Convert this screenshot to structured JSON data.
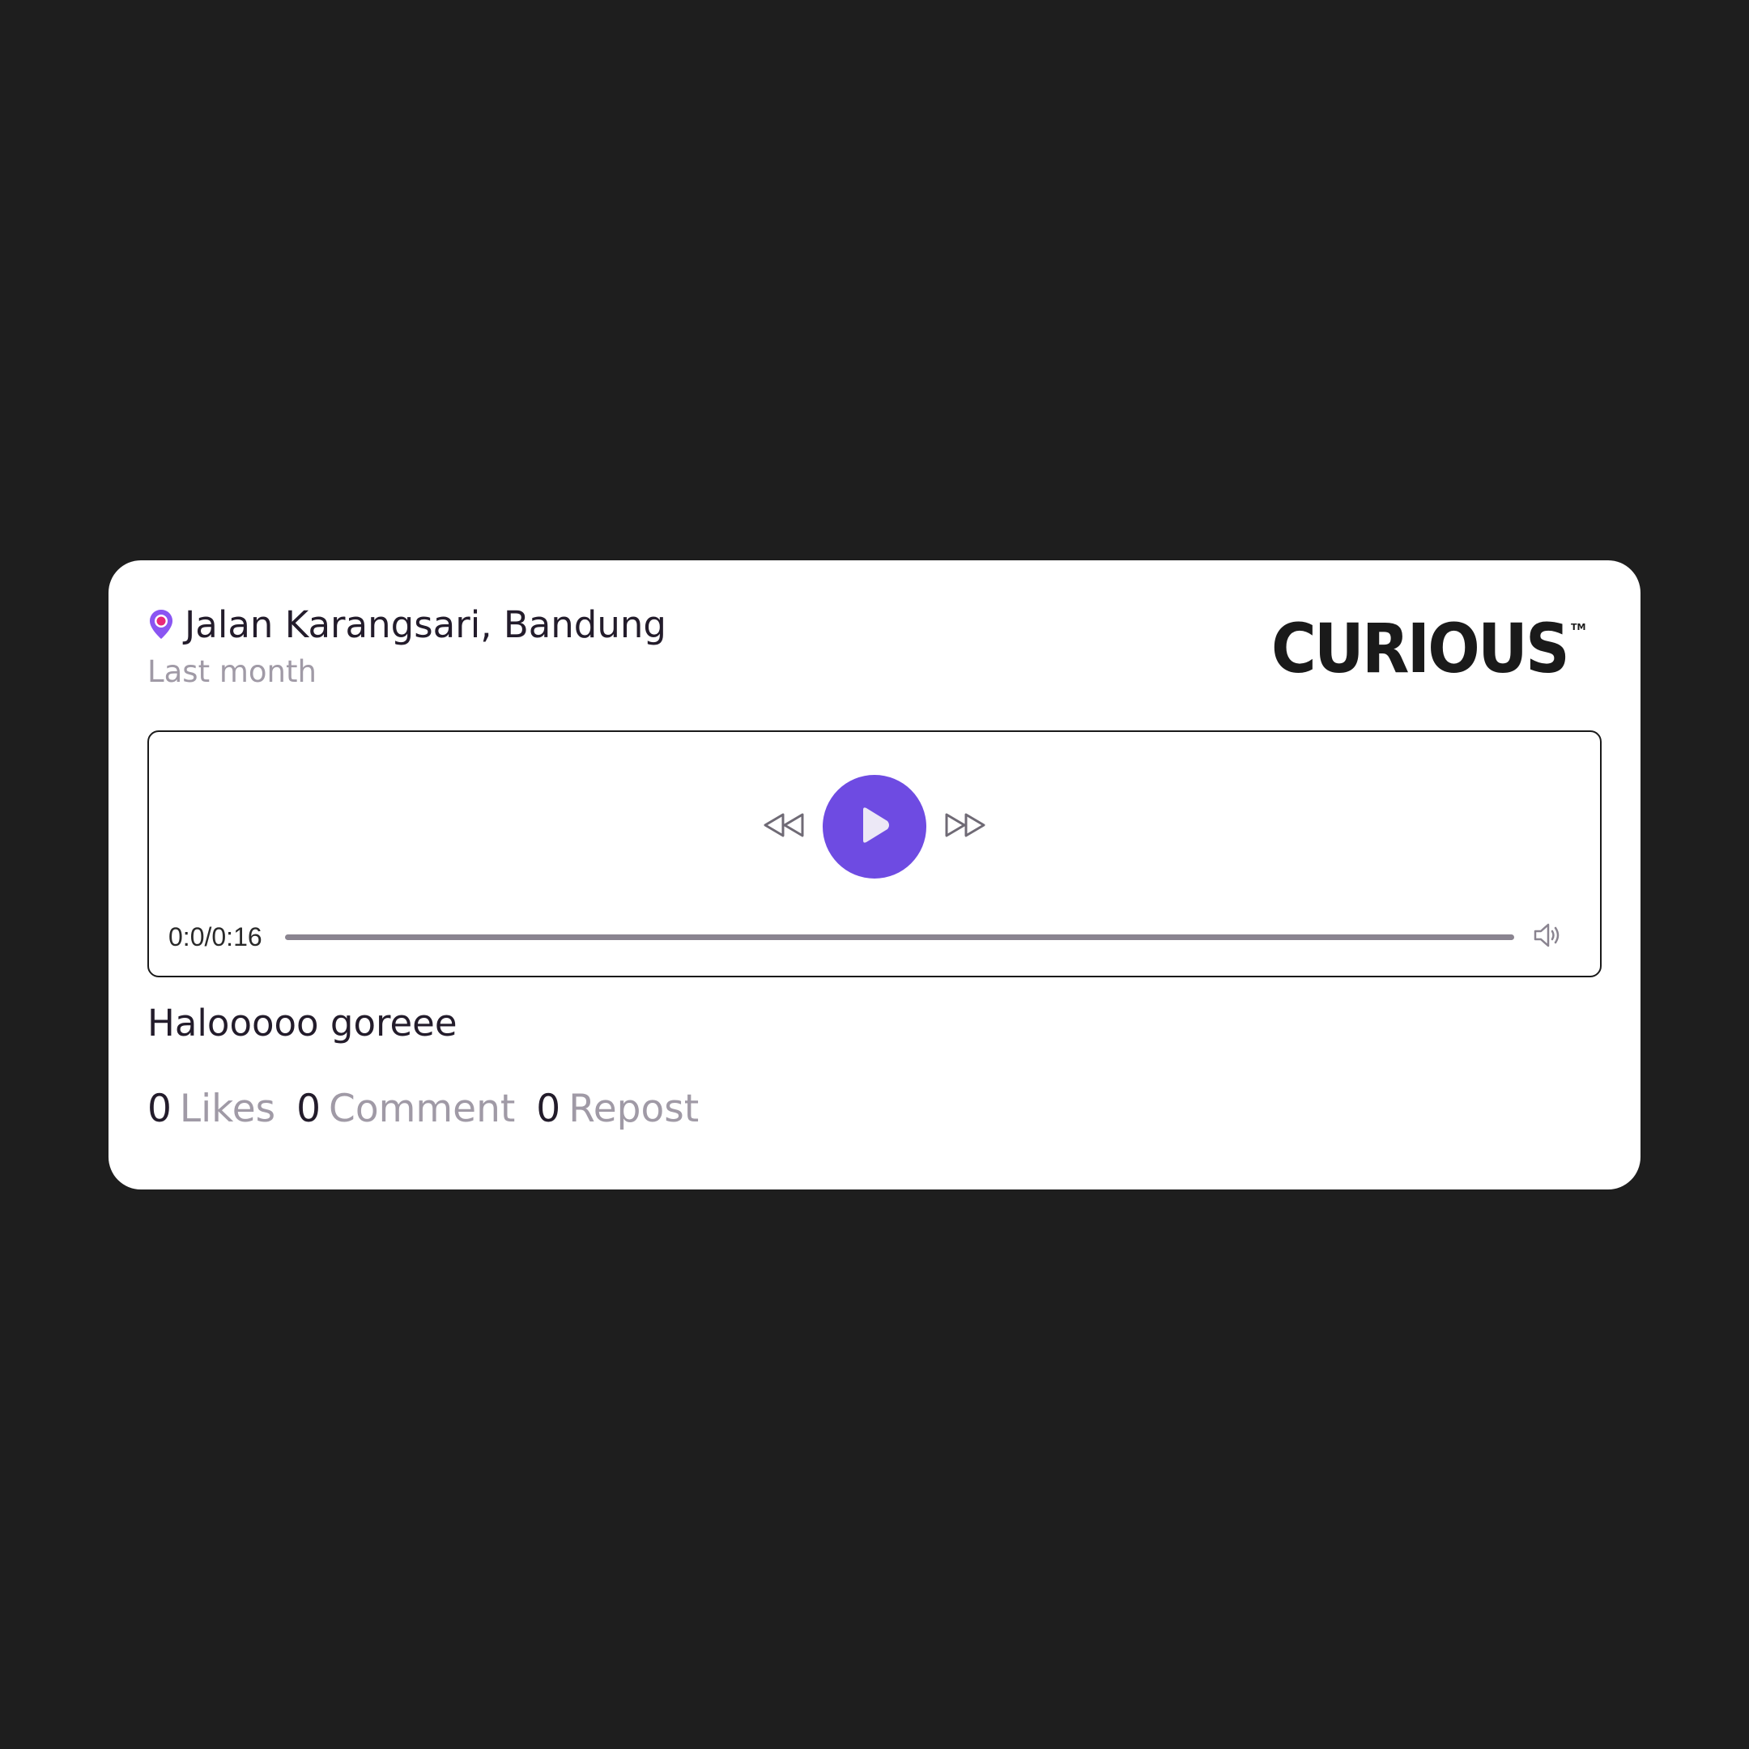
{
  "post": {
    "location": "Jalan Karangsari, Bandung",
    "time": "Last month",
    "caption": "Halooooo goreee"
  },
  "brand": {
    "logo_text": "CURIOUS",
    "trademark": "TM"
  },
  "player": {
    "time_readout": "0:0/0:16",
    "progress": 0,
    "play_icon": "play-icon",
    "rewind_icon": "rewind-icon",
    "forward_icon": "fast-forward-icon",
    "volume_icon": "volume-icon"
  },
  "stats": {
    "likes_count": "0",
    "likes_label": "Likes",
    "comment_count": "0",
    "comment_label": "Comment",
    "repost_count": "0",
    "repost_label": "Repost"
  },
  "colors": {
    "accent": "#6e4be2",
    "background": "#1e1e1e",
    "card": "#ffffff",
    "muted_text": "#a09aa6",
    "pin_outer": "#8a55f2",
    "pin_inner": "#e8287a"
  }
}
